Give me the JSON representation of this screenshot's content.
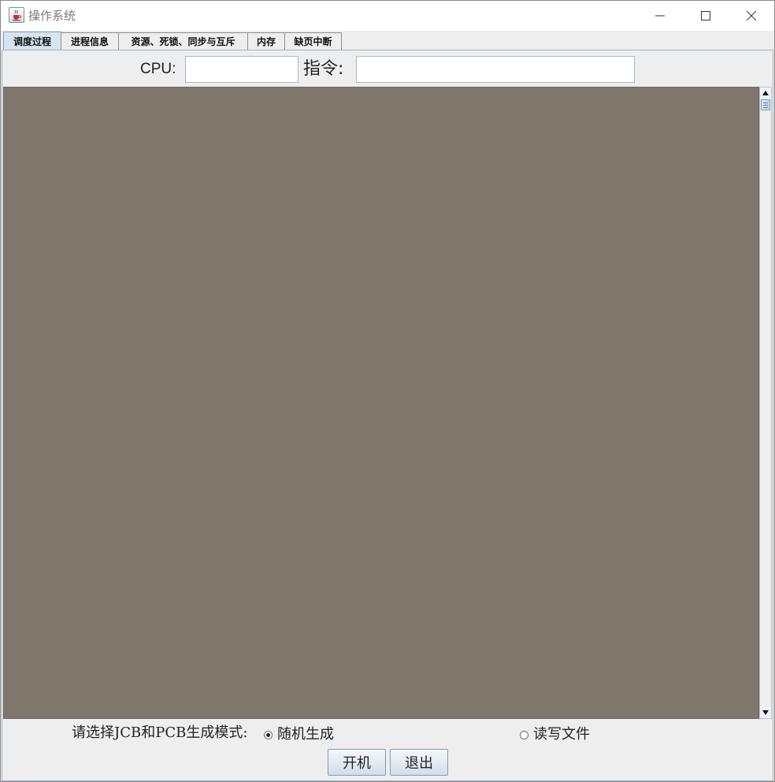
{
  "window": {
    "title": "操作系统"
  },
  "tabs": [
    {
      "label": "调度过程",
      "selected": true
    },
    {
      "label": "进程信息",
      "selected": false
    },
    {
      "label": "资源、死锁、同步与互斥",
      "selected": false
    },
    {
      "label": "内存",
      "selected": false
    },
    {
      "label": "缺页中断",
      "selected": false
    }
  ],
  "top_fields": {
    "cpu_label": "CPU:",
    "cpu_value": "",
    "instruction_label": "指令:",
    "instruction_value": ""
  },
  "canvas": {
    "background_color": "#7f776b"
  },
  "mode": {
    "label": "请选择JCB和PCB生成模式:",
    "options": [
      {
        "label": "随机生成",
        "selected": true
      },
      {
        "label": "读写文件",
        "selected": false
      }
    ]
  },
  "buttons": {
    "start": "开机",
    "exit": "退出"
  },
  "colors": {
    "selected_tab": "#d6e4f2",
    "border_accent": "#7f9db9"
  }
}
